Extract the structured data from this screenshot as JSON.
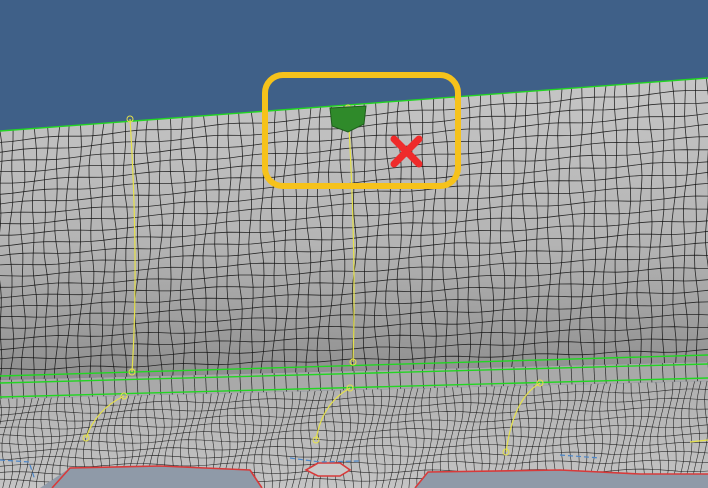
{
  "viewport": {
    "background_color": "#3f6088",
    "mesh_fill_color": "#b8b8b8",
    "mesh_line_color": "#111111",
    "feature_edge_color": "#22d622",
    "curve_color": "#e6e24a",
    "boundary_color": "#d83a3a",
    "seam_color": "#4b86c9"
  },
  "annotations": {
    "highlight_box_color": "#f6c21b",
    "error_mark_color": "#ef2b2b",
    "error_mark_icon": "cross-mark-icon",
    "selected_element_color": "#2f8a2a"
  }
}
